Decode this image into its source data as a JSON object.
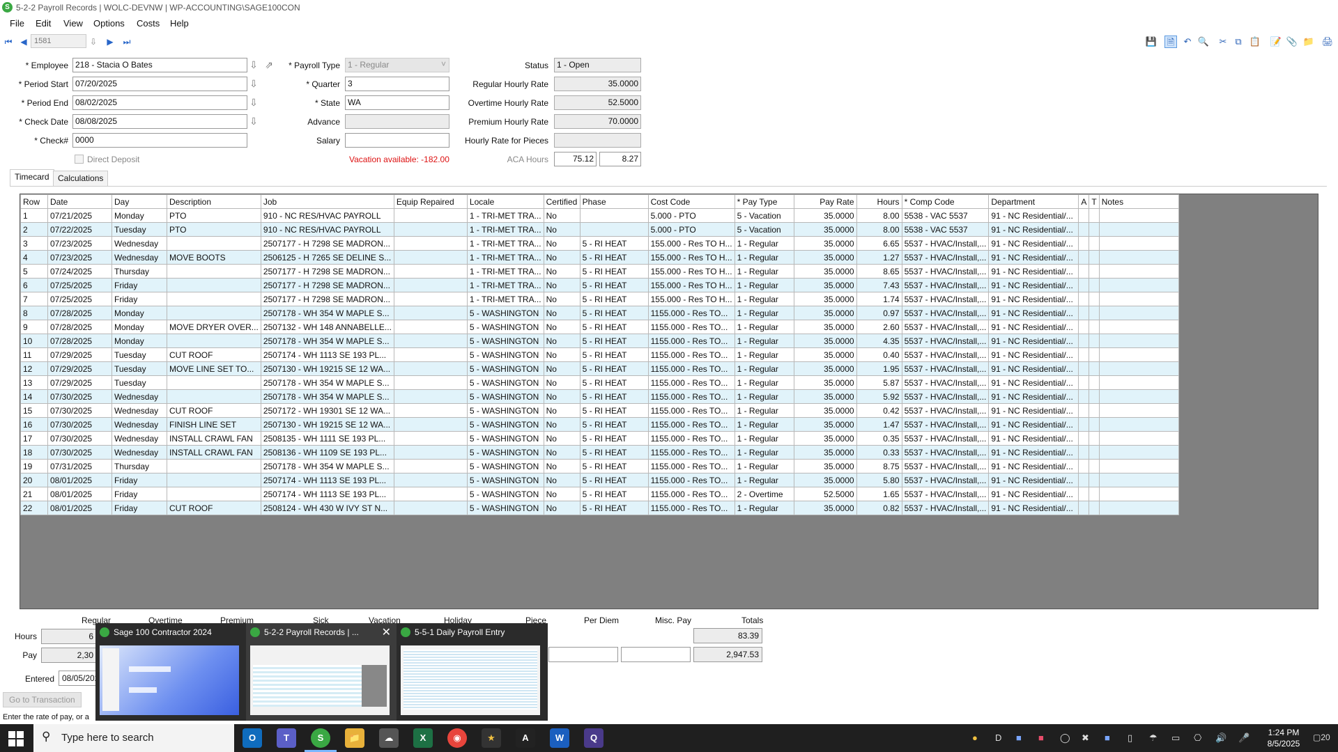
{
  "window": {
    "title": "5-2-2 Payroll Records  |  WOLC-DEVNW  |  WP-ACCOUNTING\\SAGE100CON"
  },
  "menu": [
    "File",
    "Edit",
    "View",
    "Options",
    "Costs",
    "Help"
  ],
  "toolbar": {
    "record_number": "1581"
  },
  "form": {
    "employee_label": "* Employee",
    "employee": "218 - Stacia O Bates",
    "period_start_label": "* Period Start",
    "period_start": "07/20/2025",
    "period_end_label": "* Period End",
    "period_end": "08/02/2025",
    "check_date_label": "* Check Date",
    "check_date": "08/08/2025",
    "check_no_label": "* Check#",
    "check_no": "0000",
    "direct_deposit_label": "Direct Deposit",
    "payroll_type_label": "* Payroll Type",
    "payroll_type": "1 - Regular",
    "quarter_label": "* Quarter",
    "quarter": "3",
    "state_label": "* State",
    "state": "WA",
    "advance_label": "Advance",
    "advance": "",
    "salary_label": "Salary",
    "salary": "",
    "vacation_warning": "Vacation available:  -182.00",
    "status_label": "Status",
    "status": "1 - Open",
    "regular_rate_label": "Regular Hourly Rate",
    "regular_rate": "35.0000",
    "overtime_rate_label": "Overtime Hourly Rate",
    "overtime_rate": "52.5000",
    "premium_rate_label": "Premium Hourly Rate",
    "premium_rate": "70.0000",
    "pieces_rate_label": "Hourly Rate for Pieces",
    "pieces_rate": "",
    "aca_label": "ACA Hours",
    "aca_hours_1": "75.12",
    "aca_hours_2": "8.27"
  },
  "tabs": [
    "Timecard",
    "Calculations"
  ],
  "grid": {
    "columns": [
      "Row",
      "Date",
      "Day",
      "Description",
      "Job",
      "Equip Repaired",
      "Locale",
      "Certified",
      "Phase",
      "Cost Code",
      "* Pay Type",
      "Pay Rate",
      "Hours",
      "* Comp Code",
      "Department",
      "A",
      "T",
      "Notes"
    ],
    "rows": [
      [
        "1",
        "07/21/2025",
        "Monday",
        "PTO",
        "910 - NC RES/HVAC PAYROLL",
        "",
        "1 - TRI-MET TRA...",
        "No",
        "",
        "5.000 - PTO",
        "5 - Vacation",
        "35.0000",
        "8.00",
        "5538 - VAC 5537",
        "91 - NC Residential/...",
        "",
        "",
        ""
      ],
      [
        "2",
        "07/22/2025",
        "Tuesday",
        "PTO",
        "910 - NC RES/HVAC PAYROLL",
        "",
        "1 - TRI-MET TRA...",
        "No",
        "",
        "5.000 - PTO",
        "5 - Vacation",
        "35.0000",
        "8.00",
        "5538 - VAC 5537",
        "91 - NC Residential/...",
        "",
        "",
        ""
      ],
      [
        "3",
        "07/23/2025",
        "Wednesday",
        "",
        "2507177 - H 7298 SE MADRON...",
        "",
        "1 - TRI-MET TRA...",
        "No",
        "5 - RI HEAT",
        "155.000 - Res TO H...",
        "1 - Regular",
        "35.0000",
        "6.65",
        "5537 - HVAC/Install,...",
        "91 - NC Residential/...",
        "",
        "",
        ""
      ],
      [
        "4",
        "07/23/2025",
        "Wednesday",
        "MOVE BOOTS",
        "2506125 - H 7265 SE DELINE S...",
        "",
        "1 - TRI-MET TRA...",
        "No",
        "5 - RI HEAT",
        "155.000 - Res TO H...",
        "1 - Regular",
        "35.0000",
        "1.27",
        "5537 - HVAC/Install,...",
        "91 - NC Residential/...",
        "",
        "",
        ""
      ],
      [
        "5",
        "07/24/2025",
        "Thursday",
        "",
        "2507177 - H 7298 SE MADRON...",
        "",
        "1 - TRI-MET TRA...",
        "No",
        "5 - RI HEAT",
        "155.000 - Res TO H...",
        "1 - Regular",
        "35.0000",
        "8.65",
        "5537 - HVAC/Install,...",
        "91 - NC Residential/...",
        "",
        "",
        ""
      ],
      [
        "6",
        "07/25/2025",
        "Friday",
        "",
        "2507177 - H 7298 SE MADRON...",
        "",
        "1 - TRI-MET TRA...",
        "No",
        "5 - RI HEAT",
        "155.000 - Res TO H...",
        "1 - Regular",
        "35.0000",
        "7.43",
        "5537 - HVAC/Install,...",
        "91 - NC Residential/...",
        "",
        "",
        ""
      ],
      [
        "7",
        "07/25/2025",
        "Friday",
        "",
        "2507177 - H 7298 SE MADRON...",
        "",
        "1 - TRI-MET TRA...",
        "No",
        "5 - RI HEAT",
        "155.000 - Res TO H...",
        "1 - Regular",
        "35.0000",
        "1.74",
        "5537 - HVAC/Install,...",
        "91 - NC Residential/...",
        "",
        "",
        ""
      ],
      [
        "8",
        "07/28/2025",
        "Monday",
        "",
        "2507178 - WH 354 W MAPLE S...",
        "",
        "5 - WASHINGTON",
        "No",
        "5 - RI HEAT",
        "1155.000 - Res TO...",
        "1 - Regular",
        "35.0000",
        "0.97",
        "5537 - HVAC/Install,...",
        "91 - NC Residential/...",
        "",
        "",
        ""
      ],
      [
        "9",
        "07/28/2025",
        "Monday",
        "MOVE DRYER OVER...",
        "2507132 - WH 148 ANNABELLE...",
        "",
        "5 - WASHINGTON",
        "No",
        "5 - RI HEAT",
        "1155.000 - Res TO...",
        "1 - Regular",
        "35.0000",
        "2.60",
        "5537 - HVAC/Install,...",
        "91 - NC Residential/...",
        "",
        "",
        ""
      ],
      [
        "10",
        "07/28/2025",
        "Monday",
        "",
        "2507178 - WH 354 W MAPLE S...",
        "",
        "5 - WASHINGTON",
        "No",
        "5 - RI HEAT",
        "1155.000 - Res TO...",
        "1 - Regular",
        "35.0000",
        "4.35",
        "5537 - HVAC/Install,...",
        "91 - NC Residential/...",
        "",
        "",
        ""
      ],
      [
        "11",
        "07/29/2025",
        "Tuesday",
        "CUT ROOF",
        "2507174 - WH 1113 SE 193 PL...",
        "",
        "5 - WASHINGTON",
        "No",
        "5 - RI HEAT",
        "1155.000 - Res TO...",
        "1 - Regular",
        "35.0000",
        "0.40",
        "5537 - HVAC/Install,...",
        "91 - NC Residential/...",
        "",
        "",
        ""
      ],
      [
        "12",
        "07/29/2025",
        "Tuesday",
        "MOVE LINE SET TO...",
        "2507130 - WH 19215 SE 12 WA...",
        "",
        "5 - WASHINGTON",
        "No",
        "5 - RI HEAT",
        "1155.000 - Res TO...",
        "1 - Regular",
        "35.0000",
        "1.95",
        "5537 - HVAC/Install,...",
        "91 - NC Residential/...",
        "",
        "",
        ""
      ],
      [
        "13",
        "07/29/2025",
        "Tuesday",
        "",
        "2507178 - WH 354 W MAPLE S...",
        "",
        "5 - WASHINGTON",
        "No",
        "5 - RI HEAT",
        "1155.000 - Res TO...",
        "1 - Regular",
        "35.0000",
        "5.87",
        "5537 - HVAC/Install,...",
        "91 - NC Residential/...",
        "",
        "",
        ""
      ],
      [
        "14",
        "07/30/2025",
        "Wednesday",
        "",
        "2507178 - WH 354 W MAPLE S...",
        "",
        "5 - WASHINGTON",
        "No",
        "5 - RI HEAT",
        "1155.000 - Res TO...",
        "1 - Regular",
        "35.0000",
        "5.92",
        "5537 - HVAC/Install,...",
        "91 - NC Residential/...",
        "",
        "",
        ""
      ],
      [
        "15",
        "07/30/2025",
        "Wednesday",
        "CUT ROOF",
        "2507172 - WH 19301 SE 12 WA...",
        "",
        "5 - WASHINGTON",
        "No",
        "5 - RI HEAT",
        "1155.000 - Res TO...",
        "1 - Regular",
        "35.0000",
        "0.42",
        "5537 - HVAC/Install,...",
        "91 - NC Residential/...",
        "",
        "",
        ""
      ],
      [
        "16",
        "07/30/2025",
        "Wednesday",
        "FINISH LINE SET",
        "2507130 - WH 19215 SE 12 WA...",
        "",
        "5 - WASHINGTON",
        "No",
        "5 - RI HEAT",
        "1155.000 - Res TO...",
        "1 - Regular",
        "35.0000",
        "1.47",
        "5537 - HVAC/Install,...",
        "91 - NC Residential/...",
        "",
        "",
        ""
      ],
      [
        "17",
        "07/30/2025",
        "Wednesday",
        "INSTALL CRAWL FAN",
        "2508135 - WH 1111 SE 193 PL...",
        "",
        "5 - WASHINGTON",
        "No",
        "5 - RI HEAT",
        "1155.000 - Res TO...",
        "1 - Regular",
        "35.0000",
        "0.35",
        "5537 - HVAC/Install,...",
        "91 - NC Residential/...",
        "",
        "",
        ""
      ],
      [
        "18",
        "07/30/2025",
        "Wednesday",
        "INSTALL CRAWL FAN",
        "2508136 - WH 1109 SE 193 PL...",
        "",
        "5 - WASHINGTON",
        "No",
        "5 - RI HEAT",
        "1155.000 - Res TO...",
        "1 - Regular",
        "35.0000",
        "0.33",
        "5537 - HVAC/Install,...",
        "91 - NC Residential/...",
        "",
        "",
        ""
      ],
      [
        "19",
        "07/31/2025",
        "Thursday",
        "",
        "2507178 - WH 354 W MAPLE S...",
        "",
        "5 - WASHINGTON",
        "No",
        "5 - RI HEAT",
        "1155.000 - Res TO...",
        "1 - Regular",
        "35.0000",
        "8.75",
        "5537 - HVAC/Install,...",
        "91 - NC Residential/...",
        "",
        "",
        ""
      ],
      [
        "20",
        "08/01/2025",
        "Friday",
        "",
        "2507174 - WH 1113 SE 193 PL...",
        "",
        "5 - WASHINGTON",
        "No",
        "5 - RI HEAT",
        "1155.000 - Res TO...",
        "1 - Regular",
        "35.0000",
        "5.80",
        "5537 - HVAC/Install,...",
        "91 - NC Residential/...",
        "",
        "",
        ""
      ],
      [
        "21",
        "08/01/2025",
        "Friday",
        "",
        "2507174 - WH 1113 SE 193 PL...",
        "",
        "5 - WASHINGTON",
        "No",
        "5 - RI HEAT",
        "1155.000 - Res TO...",
        "2 - Overtime",
        "52.5000",
        "1.65",
        "5537 - HVAC/Install,...",
        "91 - NC Residential/...",
        "",
        "",
        ""
      ],
      [
        "22",
        "08/01/2025",
        "Friday",
        "CUT ROOF",
        "2508124 - WH 430 W IVY ST N...",
        "",
        "5 - WASHINGTON",
        "No",
        "5 - RI HEAT",
        "1155.000 - Res TO...",
        "1 - Regular",
        "35.0000",
        "0.82",
        "5537 - HVAC/Install,...",
        "91 - NC Residential/...",
        "",
        "",
        ""
      ]
    ]
  },
  "totals": {
    "headers": [
      "Regular",
      "Overtime",
      "Premium",
      "Sick",
      "Vacation",
      "Holiday",
      "Piece",
      "Per Diem",
      "Misc. Pay",
      "Totals"
    ],
    "hours_label": "Hours",
    "pay_label": "Pay",
    "regular_hours_partial": "6",
    "regular_pay_partial": "2,30",
    "total_hours": "83.39",
    "total_pay": "2,947.53",
    "entered_label": "Entered",
    "entered_partial": "08/05/202"
  },
  "thumbnails": [
    {
      "title": "Sage 100 Contractor 2024"
    },
    {
      "title": "5-2-2 Payroll Records  | ..."
    },
    {
      "title": "5-5-1 Daily Payroll Entry"
    }
  ],
  "status": {
    "goto_button": "Go to Transaction",
    "hint": "Enter the rate of pay, or a"
  },
  "taskbar": {
    "search_placeholder": "Type here to search",
    "time": "1:24 PM",
    "date": "8/5/2025",
    "notification_count": "20"
  }
}
